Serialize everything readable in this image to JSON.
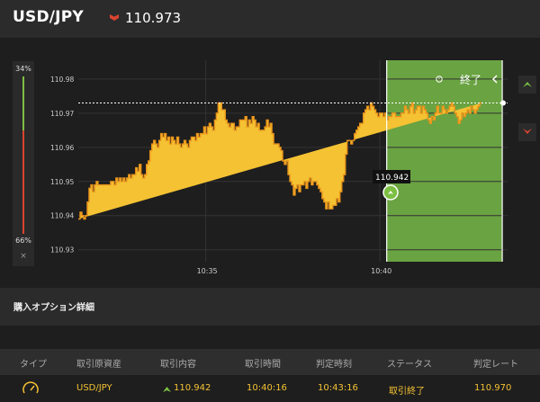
{
  "header": {
    "pair": "USD/JPY",
    "direction_icon": "down-triangle-icon",
    "price": "110.973"
  },
  "sentiment": {
    "up_pct": "34%",
    "down_pct": "66%",
    "close_label": "×"
  },
  "chart": {
    "expiry_label": "終了",
    "tooltip_price": "110.942",
    "call_icon": "up-arrow-icon",
    "put_icon": "down-arrow-icon"
  },
  "section": {
    "title": "購入オプション詳細"
  },
  "table": {
    "headers": [
      "タイプ",
      "取引原資産",
      "取引内容",
      "取引時間",
      "判定時刻",
      "ステータス",
      "判定レート"
    ],
    "row": {
      "type_icon": "gauge-icon",
      "asset": "USD/JPY",
      "direction_icon": "up-arrow-icon",
      "strike": "110.942",
      "trade_time": "10:40:16",
      "judge_time": "10:43:16",
      "status": "取引終了",
      "rate": "110.970"
    }
  },
  "colors": {
    "area": "#f4c233",
    "area_line": "#e8921a",
    "window": "#6aa342",
    "put": "#d9442f",
    "call": "#7cc043"
  },
  "chart_data": {
    "type": "area",
    "x_ticks": [
      "10:35",
      "10:40"
    ],
    "y_ticks": [
      "110.98",
      "110.97",
      "110.96",
      "110.95",
      "110.94",
      "110.93"
    ],
    "x": [
      0,
      2,
      4,
      6,
      8,
      10,
      12,
      14,
      16,
      18,
      20,
      22,
      24,
      26,
      28,
      30,
      32,
      34,
      36,
      38,
      40,
      42,
      44,
      46,
      48,
      50,
      52,
      54,
      56,
      58,
      60,
      62,
      64,
      66,
      68,
      70,
      72,
      74,
      76,
      78,
      80,
      82,
      84,
      86,
      88,
      90,
      92,
      94,
      96,
      98,
      100,
      102,
      104,
      106,
      108,
      110,
      112,
      114,
      116,
      118,
      120,
      122,
      124,
      126,
      128,
      130,
      132,
      134,
      136,
      138,
      140,
      142,
      144,
      146,
      148,
      150,
      152,
      154,
      156,
      158,
      160,
      162,
      164,
      166,
      168,
      170,
      172,
      174,
      176,
      178,
      180,
      182,
      184,
      186,
      188,
      190,
      192,
      194,
      196,
      198,
      200,
      202,
      204,
      206,
      208,
      210,
      212,
      214,
      216,
      218,
      220,
      222,
      224,
      226,
      228,
      230,
      232,
      234,
      236,
      238,
      240,
      242,
      244,
      246,
      248,
      250,
      252,
      254,
      256,
      258,
      260,
      262,
      264,
      266,
      268,
      270,
      272,
      274,
      276,
      278,
      280,
      282,
      284,
      286,
      288,
      290,
      292,
      294,
      296,
      298,
      300,
      302,
      304,
      306,
      308,
      310,
      312,
      314,
      316,
      318,
      320,
      322,
      324,
      326,
      328,
      330,
      332,
      334,
      336,
      338,
      340,
      342,
      344,
      346,
      348,
      350,
      352,
      354,
      356,
      358,
      360,
      362,
      364,
      366,
      368,
      370,
      372,
      374,
      376,
      378,
      380,
      382,
      384,
      386,
      388,
      390,
      392,
      394,
      396,
      398,
      400,
      402,
      404,
      406,
      408,
      410,
      412,
      414,
      416,
      418,
      420,
      422,
      424,
      426,
      428,
      430,
      432,
      434,
      436,
      438,
      440,
      442,
      444,
      446,
      448,
      450,
      452,
      454,
      456,
      458,
      460,
      462,
      464,
      466,
      468,
      470,
      472,
      474
    ],
    "values": [
      110.939,
      110.941,
      110.94,
      110.939,
      110.94,
      110.944,
      110.948,
      110.949,
      110.947,
      110.949,
      110.95,
      110.949,
      110.949,
      110.949,
      110.949,
      110.949,
      110.949,
      110.949,
      110.95,
      110.95,
      110.949,
      110.951,
      110.95,
      110.951,
      110.95,
      110.951,
      110.95,
      110.951,
      110.952,
      110.951,
      110.952,
      110.952,
      110.954,
      110.953,
      110.955,
      110.952,
      110.951,
      110.952,
      110.955,
      110.956,
      110.959,
      110.961,
      110.962,
      110.961,
      110.96,
      110.962,
      110.964,
      110.963,
      110.964,
      110.962,
      110.963,
      110.961,
      110.963,
      110.962,
      110.961,
      110.963,
      110.961,
      110.96,
      110.961,
      110.962,
      110.961,
      110.96,
      110.962,
      110.963,
      110.963,
      110.962,
      110.964,
      110.963,
      110.964,
      110.964,
      110.966,
      110.964,
      110.966,
      110.967,
      110.966,
      110.965,
      110.968,
      110.97,
      110.973,
      110.973,
      110.971,
      110.971,
      110.968,
      110.967,
      110.966,
      110.967,
      110.967,
      110.965,
      110.966,
      110.966,
      110.968,
      110.968,
      110.968,
      110.969,
      110.966,
      110.968,
      110.967,
      110.969,
      110.968,
      110.966,
      110.967,
      110.965,
      110.965,
      110.965,
      110.966,
      110.968,
      110.966,
      110.967,
      110.964,
      110.961,
      110.961,
      110.961,
      110.96,
      110.959,
      110.956,
      110.955,
      110.956,
      110.952,
      110.95,
      110.949,
      110.946,
      110.948,
      110.949,
      110.947,
      110.949,
      110.949,
      110.95,
      110.948,
      110.95,
      110.951,
      110.949,
      110.95,
      110.95,
      110.949,
      110.948,
      110.947,
      110.945,
      110.944,
      110.942,
      110.944,
      110.942,
      110.942,
      110.943,
      110.943,
      110.945,
      110.944,
      110.947,
      110.95,
      110.952,
      110.958,
      110.962,
      110.962,
      110.961,
      110.962,
      110.964,
      110.965,
      110.966,
      110.967,
      110.967,
      110.97,
      110.971,
      110.972,
      110.971,
      110.973,
      110.972,
      110.971,
      110.97,
      110.969,
      110.97,
      110.97,
      110.969,
      110.97,
      110.968,
      110.969,
      110.969,
      110.97,
      110.97,
      110.969,
      110.969,
      110.969,
      110.97,
      110.97,
      110.972,
      110.971,
      110.97,
      110.972,
      110.973,
      110.97,
      110.971,
      110.972,
      110.972,
      110.97,
      110.972,
      110.971,
      110.97,
      110.968,
      110.967,
      110.969,
      110.968,
      110.97,
      110.972,
      110.97,
      110.97,
      110.972,
      110.971,
      110.97,
      110.971,
      110.972,
      110.973,
      110.972,
      110.97,
      110.969,
      110.967,
      110.968,
      110.97,
      110.969,
      110.97,
      110.971,
      110.97,
      110.972,
      110.971,
      110.97,
      110.971,
      110.972,
      110.973
    ],
    "ylim": [
      110.9265,
      110.9855
    ],
    "reference_price": 110.973,
    "entry_time_fraction": 0.726,
    "expiry_time_fraction": 0.998,
    "grid": true
  }
}
